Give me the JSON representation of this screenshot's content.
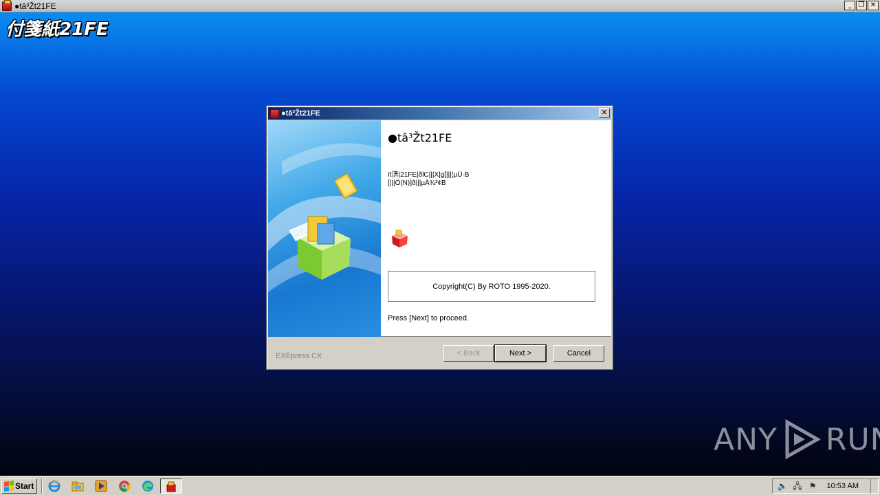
{
  "window": {
    "title": "●tâ³Žt21FE",
    "minimize": "_",
    "restore": "❐",
    "close": "✕"
  },
  "desktop": {
    "brand_title": "付箋紙21FE"
  },
  "dialog": {
    "title": "●tâ³Žt21FE",
    "close": "✕",
    "heading": "●tâ³Žt21FE",
    "description_line1": "ït㳥|21FE|ðlC|||X|g[|||¦µÜ·B",
    "description_line2": "[|||Ö(N)]ð|||µÄ­¾³¢B",
    "copyright": "Copyright(C) By ROTO 1995-2020.",
    "proceed": "Press [Next] to proceed.",
    "footer_brand": "EXEpress CX",
    "buttons": {
      "back": "< Back",
      "next": "Next >",
      "cancel": "Cancel"
    }
  },
  "watermark": {
    "left": "ANY",
    "right": "RUN"
  },
  "taskbar": {
    "start_label": "Start",
    "quick_launch": [
      "ie-icon",
      "explorer-icon",
      "media-player-icon",
      "chrome-icon",
      "edge-icon"
    ],
    "active_task": "installer-icon",
    "clock": "10:53 AM"
  }
}
